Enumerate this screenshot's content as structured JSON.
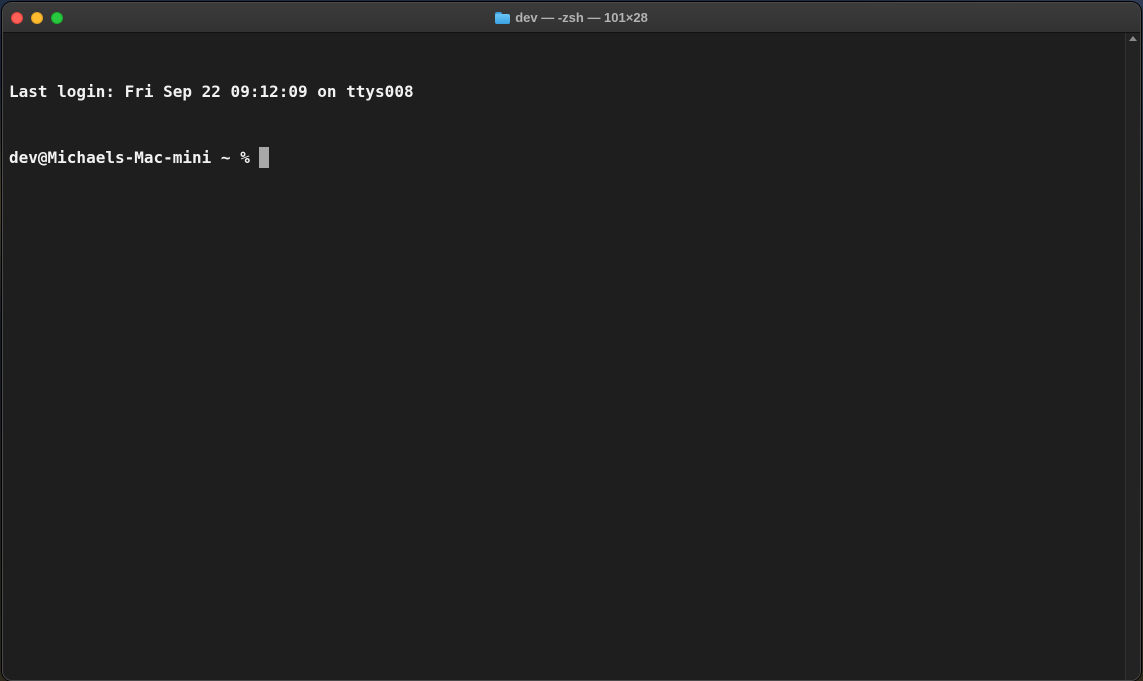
{
  "window": {
    "title": "dev — -zsh — 101×28",
    "folder_icon": "folder-icon"
  },
  "terminal": {
    "last_login": "Last login: Fri Sep 22 09:12:09 on ttys008",
    "prompt": "dev@Michaels-Mac-mini ~ % "
  },
  "colors": {
    "close": "#fe5f57",
    "minimize": "#febc2e",
    "zoom": "#28c840",
    "terminal_bg": "#1e1e1e",
    "terminal_fg": "#f2f2f2",
    "cursor": "#a8a8a8"
  }
}
